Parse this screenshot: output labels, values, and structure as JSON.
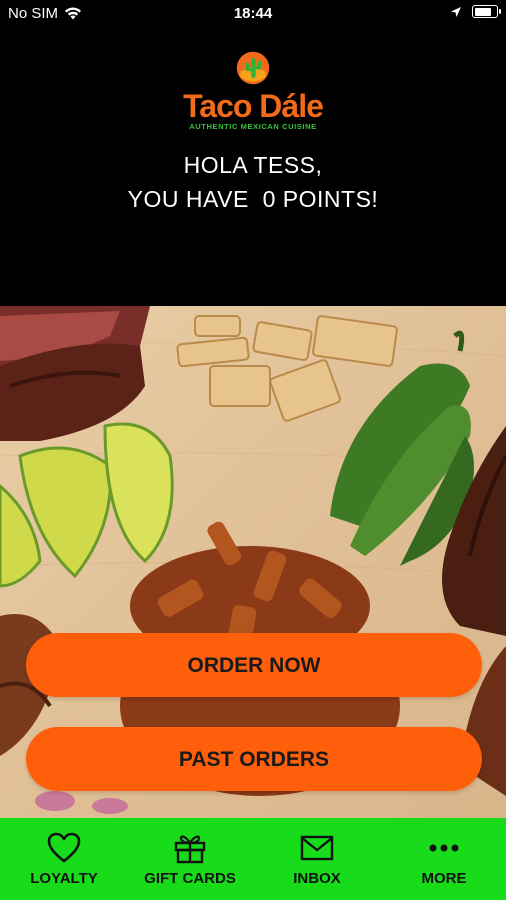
{
  "status_bar": {
    "carrier": "No SIM",
    "time": "18:44"
  },
  "brand": {
    "name": "Taco Dále",
    "tagline": "AUTHENTIC MEXICAN CUISINE",
    "colors": {
      "primary": "#f26a1b",
      "accent": "#35c43a"
    }
  },
  "greeting": {
    "line1": "HOLA TESS,",
    "line2": "YOU HAVE  0 POINTS!"
  },
  "actions": {
    "order_now": "ORDER NOW",
    "past_orders": "PAST ORDERS",
    "button_color": "#ff5f0a"
  },
  "tabbar": {
    "color": "#18db1a",
    "items": [
      {
        "label": "LOYALTY",
        "icon": "heart-icon"
      },
      {
        "label": "GIFT CARDS",
        "icon": "gift-icon"
      },
      {
        "label": "INBOX",
        "icon": "mail-icon"
      },
      {
        "label": "MORE",
        "icon": "more-icon"
      }
    ]
  }
}
